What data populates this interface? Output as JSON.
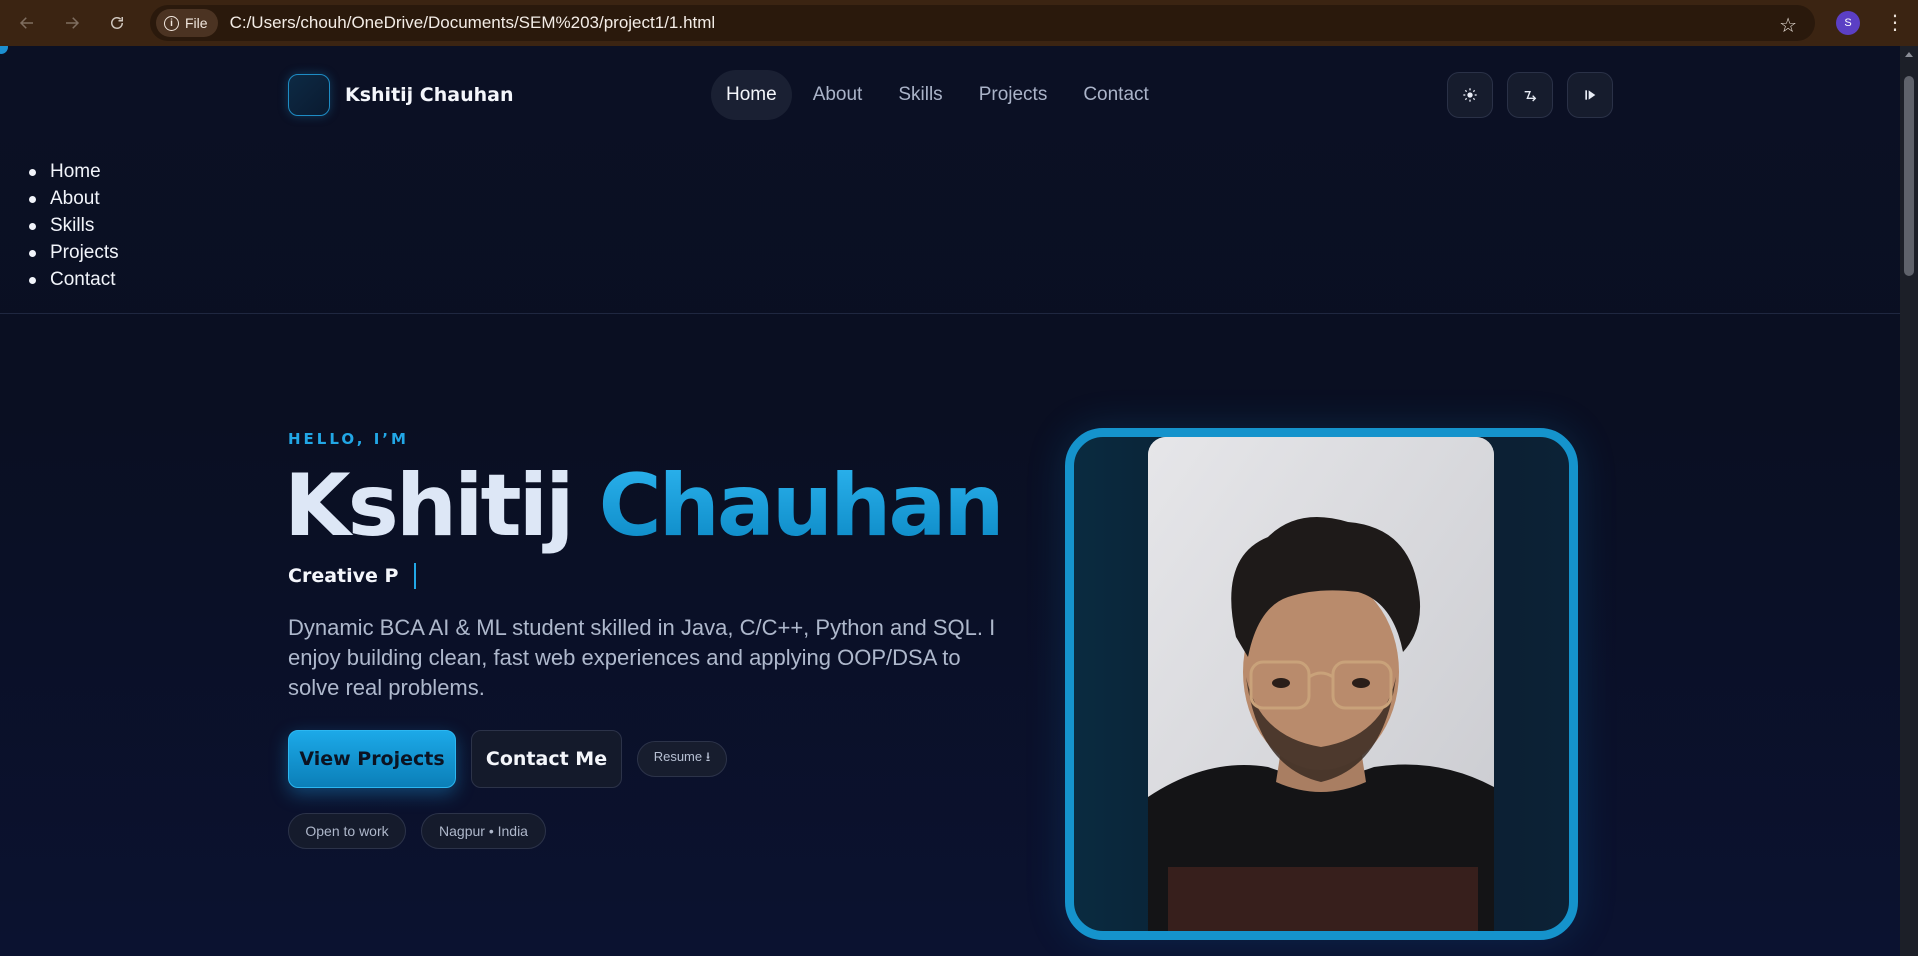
{
  "browser": {
    "file_chip": "File",
    "url": "C:/Users/chouh/OneDrive/Documents/SEM%203/project1/1.html",
    "profile_initial": "S"
  },
  "header": {
    "brand_name": "Kshitij Chauhan",
    "nav": [
      "Home",
      "About",
      "Skills",
      "Projects",
      "Contact"
    ],
    "active_nav": "Home",
    "icons": [
      "sun-icon",
      "shuffle-icon",
      "play-icon"
    ]
  },
  "fallback_nav": [
    "Home",
    "About",
    "Skills",
    "Projects",
    "Contact"
  ],
  "hero": {
    "greeting": "HELLO, I’M",
    "first_name": "Kshitij",
    "last_name": "Chauhan",
    "typed_text": "Creative P",
    "description": "Dynamic BCA AI & ML student skilled in Java, C/C++, Python and SQL. I enjoy building clean, fast web experiences and applying OOP/DSA to solve real problems.",
    "primary_cta": "View Projects",
    "secondary_cta": "Contact Me",
    "resume_label": "Resume ⭳",
    "chips": [
      "Open to work",
      "Nagpur • India"
    ]
  },
  "colors": {
    "accent": "#1ca9e8",
    "background": "#0a0f24",
    "chrome": "#3b2412"
  }
}
